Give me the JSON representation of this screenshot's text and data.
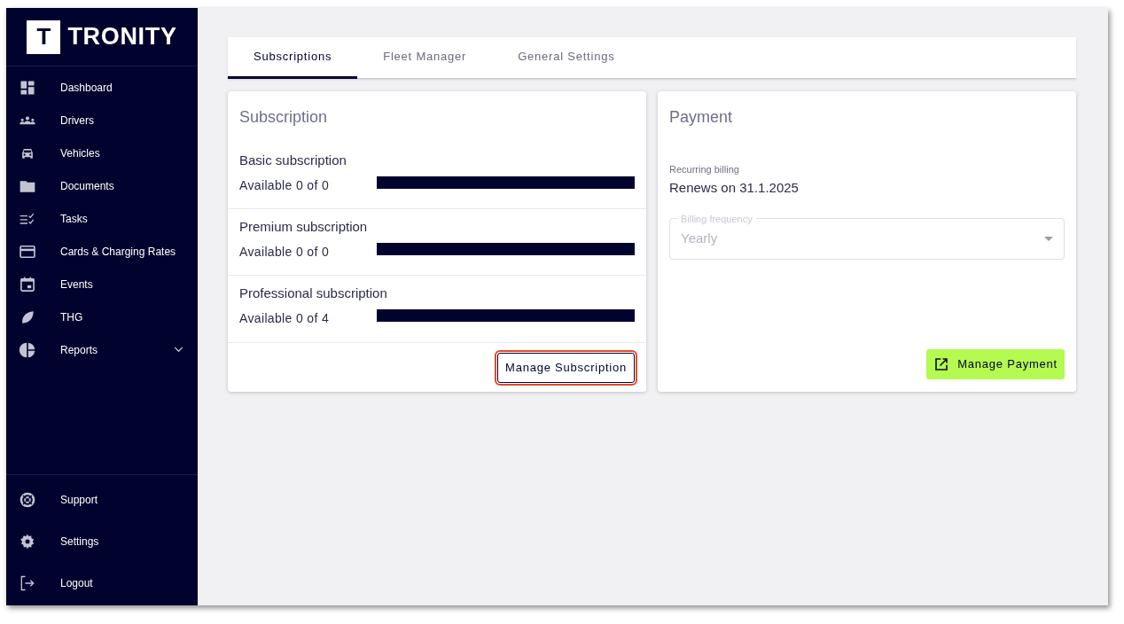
{
  "brand": {
    "logo_letter": "T",
    "name": "TRONITY"
  },
  "sidebar": {
    "items": [
      {
        "kind": "dashboard",
        "label": "Dashboard",
        "expandable": false
      },
      {
        "kind": "drivers",
        "label": "Drivers",
        "expandable": false
      },
      {
        "kind": "vehicles",
        "label": "Vehicles",
        "expandable": false
      },
      {
        "kind": "documents",
        "label": "Documents",
        "expandable": false
      },
      {
        "kind": "tasks",
        "label": "Tasks",
        "expandable": false
      },
      {
        "kind": "cards",
        "label": "Cards & Charging Rates",
        "expandable": false
      },
      {
        "kind": "events",
        "label": "Events",
        "expandable": false
      },
      {
        "kind": "thg",
        "label": "THG",
        "expandable": false
      },
      {
        "kind": "reports",
        "label": "Reports",
        "expandable": true
      }
    ],
    "bottom_items": [
      {
        "kind": "support",
        "label": "Support"
      },
      {
        "kind": "settings",
        "label": "Settings"
      },
      {
        "kind": "logout",
        "label": "Logout"
      }
    ]
  },
  "tabs": [
    {
      "label": "Subscriptions",
      "selected": true
    },
    {
      "label": "Fleet Manager",
      "selected": false
    },
    {
      "label": "General Settings",
      "selected": false
    }
  ],
  "subscription_card": {
    "title": "Subscription",
    "plans": [
      {
        "name": "Basic subscription",
        "availability": "Available 0 of 0",
        "level": 1
      },
      {
        "name": "Premium subscription",
        "availability": "Available 0 of 0",
        "level": 1
      },
      {
        "name": "Professional subscription",
        "availability": "Available 0 of 4",
        "level": 1
      }
    ],
    "button": {
      "label": "Manage Subscription",
      "highlighted": true
    }
  },
  "payment_card": {
    "title": "Payment",
    "billing_label": "Recurring billing",
    "billing_value": "Renews on 31.1.2025",
    "frequency_field": {
      "label": "Billing frequency",
      "value": "Yearly",
      "disabled": true
    },
    "button": {
      "label": "Manage Payment"
    }
  }
}
